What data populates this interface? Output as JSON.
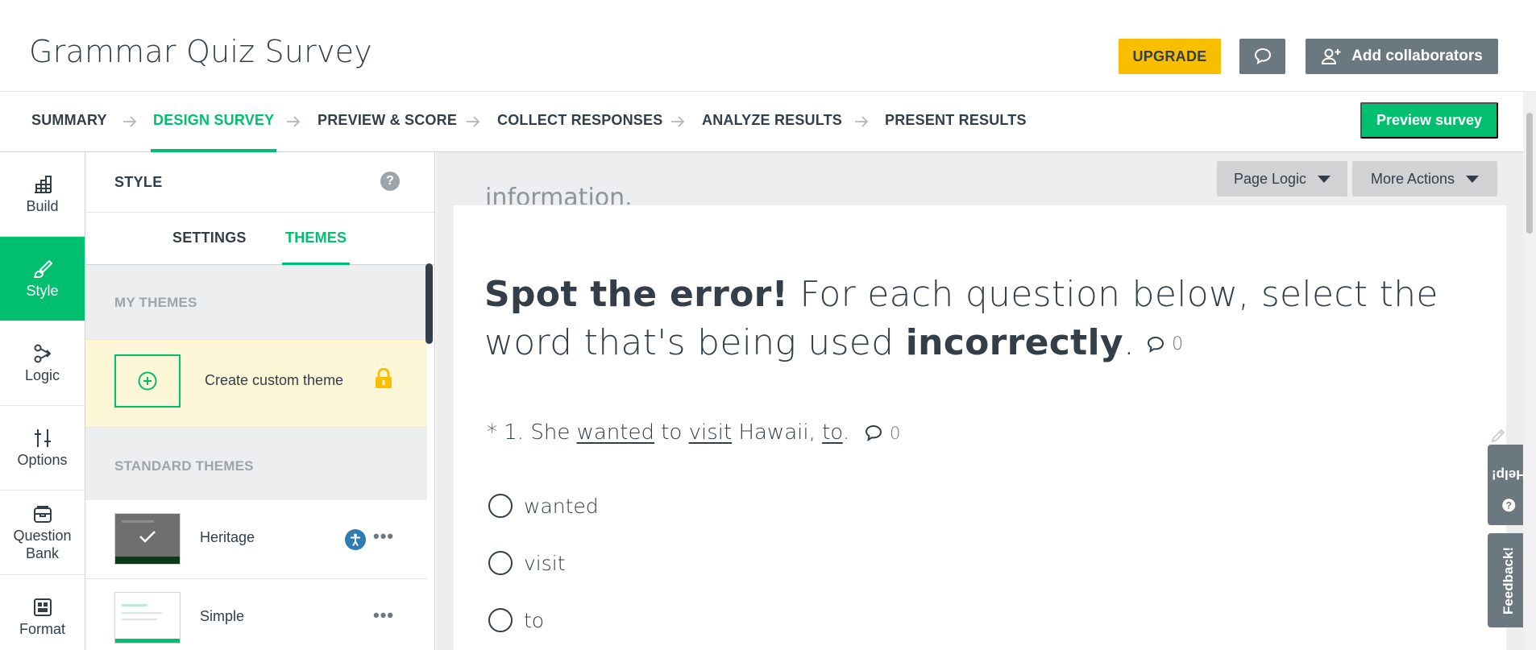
{
  "header": {
    "title": "Grammar Quiz Survey",
    "upgrade_label": "UPGRADE",
    "comment_icon": "speech-bubble-icon",
    "collab_label": "Add collaborators",
    "collab_icon": "add-user-icon"
  },
  "nav": {
    "items": [
      {
        "label": "SUMMARY"
      },
      {
        "label": "DESIGN SURVEY"
      },
      {
        "label": "PREVIEW & SCORE"
      },
      {
        "label": "COLLECT RESPONSES"
      },
      {
        "label": "ANALYZE RESULTS"
      },
      {
        "label": "PRESENT RESULTS"
      }
    ],
    "active": "DESIGN SURVEY",
    "preview_label": "Preview survey"
  },
  "rail": {
    "items": [
      {
        "label": "Build",
        "icon": "build-icon"
      },
      {
        "label": "Style",
        "icon": "brush-icon"
      },
      {
        "label": "Logic",
        "icon": "logic-icon"
      },
      {
        "label": "Options",
        "icon": "sliders-icon"
      },
      {
        "label": "Question Bank",
        "icon": "bank-icon"
      },
      {
        "label": "Format",
        "icon": "format-icon"
      }
    ],
    "active": "Style"
  },
  "style_panel": {
    "title": "STYLE",
    "help": "?",
    "tabs": [
      {
        "label": "SETTINGS"
      },
      {
        "label": "THEMES"
      }
    ],
    "active_tab": "THEMES",
    "my_themes_label": "MY THEMES",
    "create_custom_label": "Create custom theme",
    "standard_themes_label": "STANDARD THEMES",
    "themes": [
      {
        "name": "Heritage",
        "selected": true,
        "accessible": true
      },
      {
        "name": "Simple",
        "selected": false,
        "accessible": false
      }
    ],
    "more_glyph": "•••"
  },
  "canvas": {
    "page_logic_label": "Page Logic",
    "more_actions_label": "More Actions",
    "cut_text": "information.",
    "intro": {
      "bold_lead": "Spot the error!",
      "text_1": " For each question below, select the word that's being used ",
      "bold_word": "incorrectly",
      "text_2": ".",
      "comment_count": "0"
    },
    "question": {
      "prefix": "* 1. She ",
      "w1": "wanted",
      "mid1": " to ",
      "w2": "visit",
      "mid2": " Hawaii, ",
      "w3": "to",
      "end": ".",
      "comment_count": "0"
    },
    "options": [
      {
        "label": "wanted"
      },
      {
        "label": "visit"
      },
      {
        "label": "to"
      }
    ]
  },
  "side_tabs": {
    "help": "Help!",
    "feedback": "Feedback!"
  },
  "colors": {
    "accent": "#00bf6f",
    "upgrade": "#f9be00",
    "dark": "#333e48",
    "gray_btn": "#6b787f"
  }
}
